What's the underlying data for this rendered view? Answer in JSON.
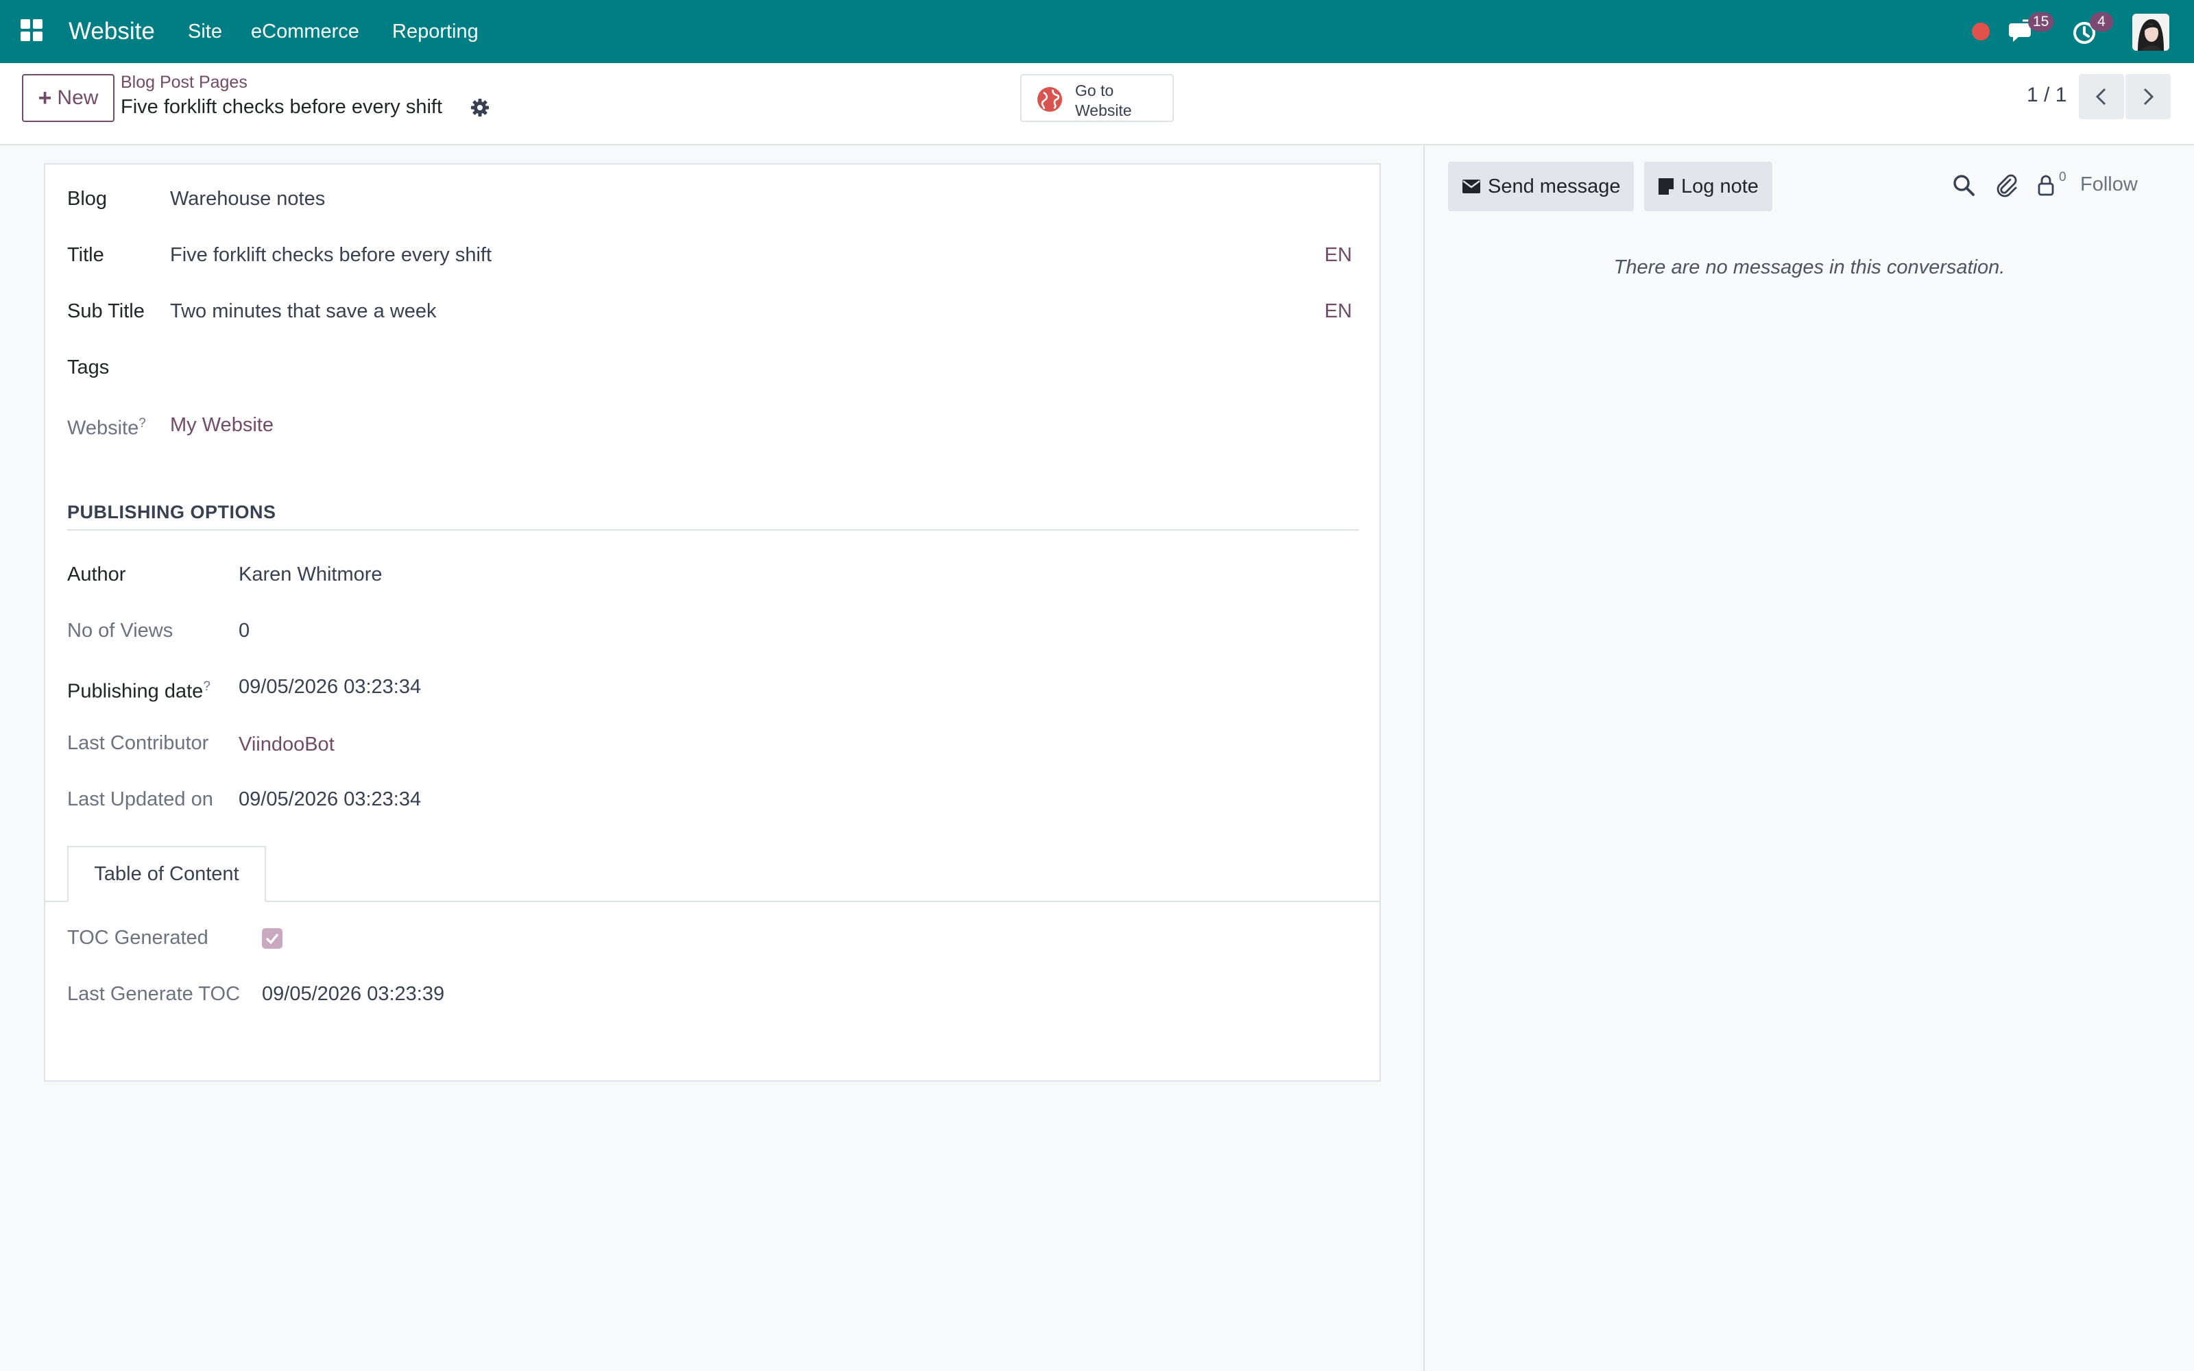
{
  "navbar": {
    "app_name": "Website",
    "menus": [
      "Site",
      "eCommerce",
      "Reporting"
    ],
    "messages_badge": "15",
    "activities_badge": "4",
    "brand_color": "#017e84"
  },
  "control_panel": {
    "new_label": "New",
    "breadcrumb": "Blog Post Pages",
    "record_title": "Five forklift checks before every shift",
    "go_to_website": "Go to Website",
    "pager": "1 / 1"
  },
  "form": {
    "fields": {
      "blog": {
        "label": "Blog",
        "value": "Warehouse notes"
      },
      "title": {
        "label": "Title",
        "value": "Five forklift checks before every shift",
        "lang": "EN"
      },
      "subtitle": {
        "label": "Sub Title",
        "value": "Two minutes that save a week",
        "lang": "EN"
      },
      "tags": {
        "label": "Tags",
        "value": ""
      },
      "website": {
        "label": "Website",
        "tooltip": "?",
        "value": "My Website"
      }
    },
    "publishing": {
      "section_title": "PUBLISHING OPTIONS",
      "author": {
        "label": "Author",
        "value": "Karen Whitmore"
      },
      "views": {
        "label": "No of Views",
        "value": "0"
      },
      "publishing_date": {
        "label": "Publishing date",
        "tooltip": "?",
        "value": "09/05/2026 03:23:34"
      },
      "last_contributor": {
        "label": "Last Contributor",
        "value": "ViindooBot"
      },
      "last_updated": {
        "label": "Last Updated on",
        "value": "09/05/2026 03:23:34"
      }
    },
    "tabs": [
      {
        "label": "Table of Content",
        "active": true
      }
    ],
    "toc": {
      "generated": {
        "label": "TOC Generated",
        "checked": true
      },
      "last_generate": {
        "label": "Last Generate TOC",
        "value": "09/05/2026 03:23:39"
      }
    }
  },
  "chatter": {
    "send_message": "Send message",
    "log_note": "Log note",
    "followers_count": "0",
    "follow_label": "Follow",
    "empty_message": "There are no messages in this conversation."
  },
  "colors": {
    "accent": "#714b67",
    "badge": "#7a4a72",
    "recording": "#e0524b"
  }
}
